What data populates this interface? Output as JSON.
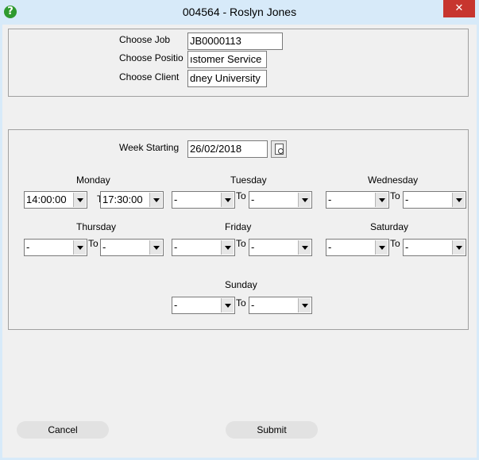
{
  "window": {
    "title": "004564 - Roslyn Jones",
    "help_icon": "?",
    "close_icon": "✕"
  },
  "job": {
    "choose_job_label": "Choose Job",
    "choose_job_value": "JB0000113",
    "choose_position_label": "Choose Positio",
    "choose_position_value": "ıstomer Service",
    "choose_client_label": "Choose Client",
    "choose_client_value": "dney University"
  },
  "schedule": {
    "week_starting_label": "Week Starting",
    "week_starting_value": "26/02/2018",
    "to_label": "To",
    "days": [
      {
        "name": "Monday",
        "from": "14:00:00",
        "to": "17:30:00"
      },
      {
        "name": "Tuesday",
        "from": "-",
        "to": "-"
      },
      {
        "name": "Wednesday",
        "from": "-",
        "to": "-"
      },
      {
        "name": "Thursday",
        "from": "-",
        "to": "-"
      },
      {
        "name": "Friday",
        "from": "-",
        "to": "-"
      },
      {
        "name": "Saturday",
        "from": "-",
        "to": "-"
      },
      {
        "name": "Sunday",
        "from": "-",
        "to": "-"
      }
    ]
  },
  "footer": {
    "cancel_label": "Cancel",
    "submit_label": "Submit"
  },
  "colors": {
    "frame": "#d7eaf9",
    "close": "#c7352e",
    "help": "#2f9a2f"
  }
}
